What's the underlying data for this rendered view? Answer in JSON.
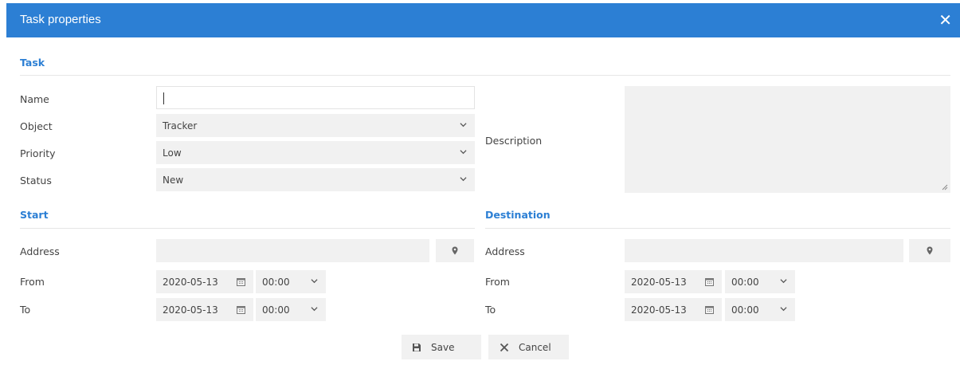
{
  "dialog": {
    "title": "Task properties",
    "close_glyph": "✕"
  },
  "task": {
    "section": "Task",
    "name_label": "Name",
    "name_value": "",
    "object_label": "Object",
    "object_value": "Tracker",
    "priority_label": "Priority",
    "priority_value": "Low",
    "status_label": "Status",
    "status_value": "New",
    "description_label": "Description",
    "description_value": ""
  },
  "start": {
    "section": "Start",
    "address_label": "Address",
    "address_value": "",
    "from_label": "From",
    "from_date": "2020-05-13",
    "from_time": "00:00",
    "to_label": "To",
    "to_date": "2020-05-13",
    "to_time": "00:00"
  },
  "destination": {
    "section": "Destination",
    "address_label": "Address",
    "address_value": "",
    "from_label": "From",
    "from_date": "2020-05-13",
    "from_time": "00:00",
    "to_label": "To",
    "to_date": "2020-05-13",
    "to_time": "00:00"
  },
  "actions": {
    "save_label": "Save",
    "cancel_label": "Cancel"
  },
  "colors": {
    "accent": "#2c7fd4",
    "field_bg": "#f1f1f1",
    "text": "#444444"
  },
  "icons": [
    "close-icon",
    "chevron-down-icon",
    "map-pin-icon",
    "calendar-icon",
    "save-icon",
    "cancel-icon"
  ]
}
